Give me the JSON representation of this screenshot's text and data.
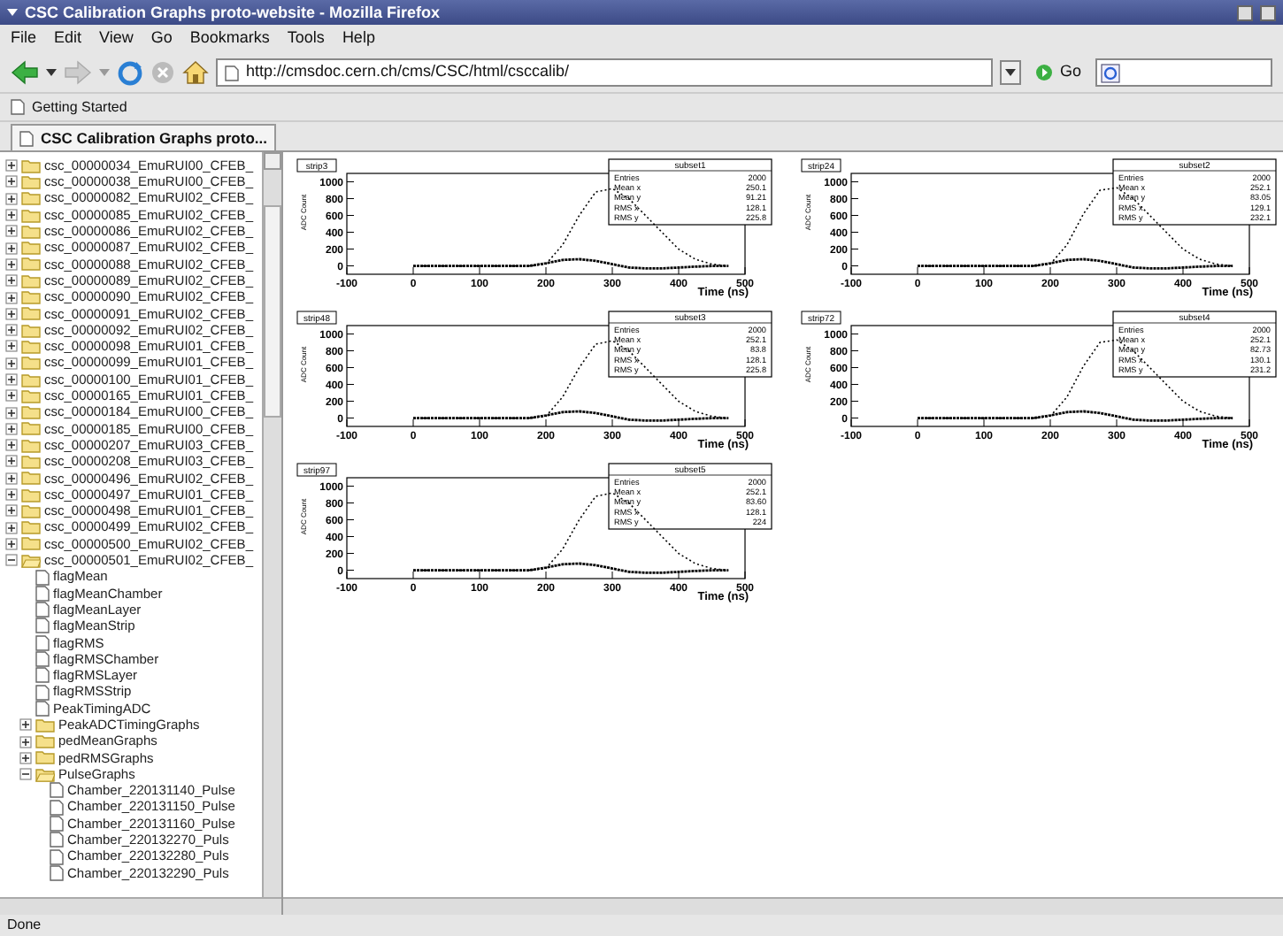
{
  "window": {
    "title": "CSC Calibration Graphs proto-website - Mozilla Firefox"
  },
  "menu": [
    "File",
    "Edit",
    "View",
    "Go",
    "Bookmarks",
    "Tools",
    "Help"
  ],
  "address": {
    "value": "http://cmsdoc.cern.ch/cms/CSC/html/csccalib/"
  },
  "go_button": "Go",
  "bookmarks": [
    "Getting Started"
  ],
  "tabs": [
    {
      "label": "CSC Calibration Graphs proto...",
      "selected": true
    }
  ],
  "tree": [
    {
      "label": "csc_00000034_EmuRUI00_CFEB_",
      "kind": "folder",
      "expanded": false
    },
    {
      "label": "csc_00000038_EmuRUI00_CFEB_",
      "kind": "folder",
      "expanded": false
    },
    {
      "label": "csc_00000082_EmuRUI02_CFEB_",
      "kind": "folder",
      "expanded": false
    },
    {
      "label": "csc_00000085_EmuRUI02_CFEB_",
      "kind": "folder",
      "expanded": false
    },
    {
      "label": "csc_00000086_EmuRUI02_CFEB_",
      "kind": "folder",
      "expanded": false
    },
    {
      "label": "csc_00000087_EmuRUI02_CFEB_",
      "kind": "folder",
      "expanded": false
    },
    {
      "label": "csc_00000088_EmuRUI02_CFEB_",
      "kind": "folder",
      "expanded": false
    },
    {
      "label": "csc_00000089_EmuRUI02_CFEB_",
      "kind": "folder",
      "expanded": false
    },
    {
      "label": "csc_00000090_EmuRUI02_CFEB_",
      "kind": "folder",
      "expanded": false
    },
    {
      "label": "csc_00000091_EmuRUI02_CFEB_",
      "kind": "folder",
      "expanded": false
    },
    {
      "label": "csc_00000092_EmuRUI02_CFEB_",
      "kind": "folder",
      "expanded": false
    },
    {
      "label": "csc_00000098_EmuRUI01_CFEB_",
      "kind": "folder",
      "expanded": false
    },
    {
      "label": "csc_00000099_EmuRUI01_CFEB_",
      "kind": "folder",
      "expanded": false
    },
    {
      "label": "csc_00000100_EmuRUI01_CFEB_",
      "kind": "folder",
      "expanded": false
    },
    {
      "label": "csc_00000165_EmuRUI01_CFEB_",
      "kind": "folder",
      "expanded": false
    },
    {
      "label": "csc_00000184_EmuRUI00_CFEB_",
      "kind": "folder",
      "expanded": false
    },
    {
      "label": "csc_00000185_EmuRUI00_CFEB_",
      "kind": "folder",
      "expanded": false
    },
    {
      "label": "csc_00000207_EmuRUI03_CFEB_",
      "kind": "folder",
      "expanded": false
    },
    {
      "label": "csc_00000208_EmuRUI03_CFEB_",
      "kind": "folder",
      "expanded": false
    },
    {
      "label": "csc_00000496_EmuRUI02_CFEB_",
      "kind": "folder",
      "expanded": false
    },
    {
      "label": "csc_00000497_EmuRUI01_CFEB_",
      "kind": "folder",
      "expanded": false
    },
    {
      "label": "csc_00000498_EmuRUI01_CFEB_",
      "kind": "folder",
      "expanded": false
    },
    {
      "label": "csc_00000499_EmuRUI02_CFEB_",
      "kind": "folder",
      "expanded": false
    },
    {
      "label": "csc_00000500_EmuRUI02_CFEB_",
      "kind": "folder",
      "expanded": false
    },
    {
      "label": "csc_00000501_EmuRUI02_CFEB_",
      "kind": "folder",
      "expanded": true,
      "children": [
        {
          "label": "flagMean",
          "kind": "file"
        },
        {
          "label": "flagMeanChamber",
          "kind": "file"
        },
        {
          "label": "flagMeanLayer",
          "kind": "file"
        },
        {
          "label": "flagMeanStrip",
          "kind": "file"
        },
        {
          "label": "flagRMS",
          "kind": "file"
        },
        {
          "label": "flagRMSChamber",
          "kind": "file"
        },
        {
          "label": "flagRMSLayer",
          "kind": "file"
        },
        {
          "label": "flagRMSStrip",
          "kind": "file"
        },
        {
          "label": "PeakTimingADC",
          "kind": "file"
        },
        {
          "label": "PeakADCTimingGraphs",
          "kind": "folder",
          "expanded": false
        },
        {
          "label": "pedMeanGraphs",
          "kind": "folder",
          "expanded": false
        },
        {
          "label": "pedRMSGraphs",
          "kind": "folder",
          "expanded": false
        },
        {
          "label": "PulseGraphs",
          "kind": "folder",
          "expanded": true,
          "children": [
            {
              "label": "Chamber_220131140_Pulse",
              "kind": "file"
            },
            {
              "label": "Chamber_220131150_Pulse",
              "kind": "file"
            },
            {
              "label": "Chamber_220131160_Pulse",
              "kind": "file"
            },
            {
              "label": "Chamber_220132270_Puls",
              "kind": "file"
            },
            {
              "label": "Chamber_220132280_Puls",
              "kind": "file"
            },
            {
              "label": "Chamber_220132290_Puls",
              "kind": "file"
            }
          ]
        }
      ]
    }
  ],
  "plots": [
    {
      "label": "strip3",
      "stats": {
        "title": "subset1",
        "rows": [
          [
            "Entries",
            "2000"
          ],
          [
            "Mean x",
            "250.1"
          ],
          [
            "Mean y",
            "91.21"
          ],
          [
            "RMS x",
            "128.1"
          ],
          [
            "RMS y",
            "225.8"
          ]
        ]
      },
      "chart_data": {
        "type": "line",
        "xlabel": "Time (ns)",
        "ylabel": "ADC Count",
        "x": [
          0,
          25,
          50,
          75,
          100,
          125,
          150,
          175,
          200,
          225,
          250,
          275,
          300,
          325,
          350,
          375,
          400,
          425,
          450,
          475
        ],
        "series": [
          {
            "color": "#000000",
            "line_style": "dotted",
            "values": [
              0,
              0,
              0,
              0,
              0,
              0,
              0,
              0,
              20,
              250,
              600,
              880,
              920,
              800,
              600,
              400,
              200,
              80,
              20,
              0
            ]
          },
          {
            "color": "#000000",
            "line_style": "dashed",
            "values": [
              0,
              0,
              0,
              0,
              0,
              0,
              0,
              0,
              30,
              70,
              80,
              60,
              20,
              -20,
              -30,
              -30,
              -20,
              -10,
              0,
              0
            ]
          }
        ],
        "xlim": [
          -100,
          500
        ],
        "ylim": [
          -100,
          1100
        ],
        "xticks": [
          -100,
          0,
          100,
          200,
          300,
          400,
          500
        ],
        "yticks": [
          0,
          200,
          400,
          600,
          800,
          1000
        ]
      }
    },
    {
      "label": "strip24",
      "stats": {
        "title": "subset2",
        "rows": [
          [
            "Entries",
            "2000"
          ],
          [
            "Mean x",
            "252.1"
          ],
          [
            "Mean y",
            "83.05"
          ],
          [
            "RMS x",
            "129.1"
          ],
          [
            "RMS y",
            "232.1"
          ]
        ]
      },
      "chart_data": {
        "type": "line",
        "xlabel": "Time (ns)",
        "ylabel": "ADC Count",
        "x": [
          0,
          25,
          50,
          75,
          100,
          125,
          150,
          175,
          200,
          225,
          250,
          275,
          300,
          325,
          350,
          375,
          400,
          425,
          450,
          475
        ],
        "series": [
          {
            "color": "#000000",
            "line_style": "dotted",
            "values": [
              0,
              0,
              0,
              0,
              0,
              0,
              0,
              0,
              20,
              250,
              620,
              900,
              930,
              800,
              600,
              400,
              200,
              80,
              20,
              0
            ]
          },
          {
            "color": "#000000",
            "line_style": "dashed",
            "values": [
              0,
              0,
              0,
              0,
              0,
              0,
              0,
              0,
              30,
              70,
              80,
              60,
              20,
              -20,
              -30,
              -30,
              -20,
              -10,
              0,
              0
            ]
          }
        ],
        "xlim": [
          -100,
          500
        ],
        "ylim": [
          -100,
          1100
        ],
        "xticks": [
          -100,
          0,
          100,
          200,
          300,
          400,
          500
        ],
        "yticks": [
          0,
          200,
          400,
          600,
          800,
          1000
        ]
      }
    },
    {
      "label": "strip48",
      "stats": {
        "title": "subset3",
        "rows": [
          [
            "Entries",
            "2000"
          ],
          [
            "Mean x",
            "252.1"
          ],
          [
            "Mean y",
            "83.8"
          ],
          [
            "RMS x",
            "128.1"
          ],
          [
            "RMS y",
            "225.8"
          ]
        ]
      },
      "chart_data": {
        "type": "line",
        "xlabel": "Time (ns)",
        "ylabel": "ADC Count",
        "x": [
          0,
          25,
          50,
          75,
          100,
          125,
          150,
          175,
          200,
          225,
          250,
          275,
          300,
          325,
          350,
          375,
          400,
          425,
          450,
          475
        ],
        "series": [
          {
            "color": "#000000",
            "line_style": "dotted",
            "values": [
              0,
              0,
              0,
              0,
              0,
              0,
              0,
              0,
              20,
              250,
              600,
              880,
              920,
              800,
              600,
              400,
              200,
              80,
              20,
              0
            ]
          },
          {
            "color": "#000000",
            "line_style": "dashed",
            "values": [
              0,
              0,
              0,
              0,
              0,
              0,
              0,
              0,
              30,
              70,
              80,
              60,
              20,
              -20,
              -30,
              -30,
              -20,
              -10,
              0,
              0
            ]
          }
        ],
        "xlim": [
          -100,
          500
        ],
        "ylim": [
          -100,
          1100
        ],
        "xticks": [
          -100,
          0,
          100,
          200,
          300,
          400,
          500
        ],
        "yticks": [
          0,
          200,
          400,
          600,
          800,
          1000
        ]
      }
    },
    {
      "label": "strip72",
      "stats": {
        "title": "subset4",
        "rows": [
          [
            "Entries",
            "2000"
          ],
          [
            "Mean x",
            "252.1"
          ],
          [
            "Mean y",
            "82.73"
          ],
          [
            "RMS x",
            "130.1"
          ],
          [
            "RMS y",
            "231.2"
          ]
        ]
      },
      "chart_data": {
        "type": "line",
        "xlabel": "Time (ns)",
        "ylabel": "ADC Count",
        "x": [
          0,
          25,
          50,
          75,
          100,
          125,
          150,
          175,
          200,
          225,
          250,
          275,
          300,
          325,
          350,
          375,
          400,
          425,
          450,
          475
        ],
        "series": [
          {
            "color": "#000000",
            "line_style": "dotted",
            "values": [
              0,
              0,
              0,
              0,
              0,
              0,
              0,
              0,
              20,
              250,
              620,
              900,
              930,
              800,
              600,
              400,
              200,
              80,
              20,
              0
            ]
          },
          {
            "color": "#000000",
            "line_style": "dashed",
            "values": [
              0,
              0,
              0,
              0,
              0,
              0,
              0,
              0,
              30,
              70,
              80,
              60,
              20,
              -20,
              -30,
              -30,
              -20,
              -10,
              0,
              0
            ]
          }
        ],
        "xlim": [
          -100,
          500
        ],
        "ylim": [
          -100,
          1100
        ],
        "xticks": [
          -100,
          0,
          100,
          200,
          300,
          400,
          500
        ],
        "yticks": [
          0,
          200,
          400,
          600,
          800,
          1000
        ]
      }
    },
    {
      "label": "strip97",
      "stats": {
        "title": "subset5",
        "rows": [
          [
            "Entries",
            "2000"
          ],
          [
            "Mean x",
            "252.1"
          ],
          [
            "Mean y",
            "83.60"
          ],
          [
            "RMS x",
            "128.1"
          ],
          [
            "RMS y",
            "224"
          ]
        ]
      },
      "chart_data": {
        "type": "line",
        "xlabel": "Time (ns)",
        "ylabel": "ADC Count",
        "x": [
          0,
          25,
          50,
          75,
          100,
          125,
          150,
          175,
          200,
          225,
          250,
          275,
          300,
          325,
          350,
          375,
          400,
          425,
          450,
          475
        ],
        "series": [
          {
            "color": "#000000",
            "line_style": "dotted",
            "values": [
              0,
              0,
              0,
              0,
              0,
              0,
              0,
              0,
              20,
              250,
              600,
              880,
              920,
              800,
              600,
              400,
              200,
              80,
              20,
              0
            ]
          },
          {
            "color": "#000000",
            "line_style": "dashed",
            "values": [
              0,
              0,
              0,
              0,
              0,
              0,
              0,
              0,
              30,
              70,
              80,
              60,
              20,
              -20,
              -30,
              -30,
              -20,
              -10,
              0,
              0
            ]
          }
        ],
        "xlim": [
          -100,
          500
        ],
        "ylim": [
          -100,
          1100
        ],
        "xticks": [
          -100,
          0,
          100,
          200,
          300,
          400,
          500
        ],
        "yticks": [
          0,
          200,
          400,
          600,
          800,
          1000
        ]
      }
    }
  ],
  "status_bar": {
    "text": "Done"
  }
}
